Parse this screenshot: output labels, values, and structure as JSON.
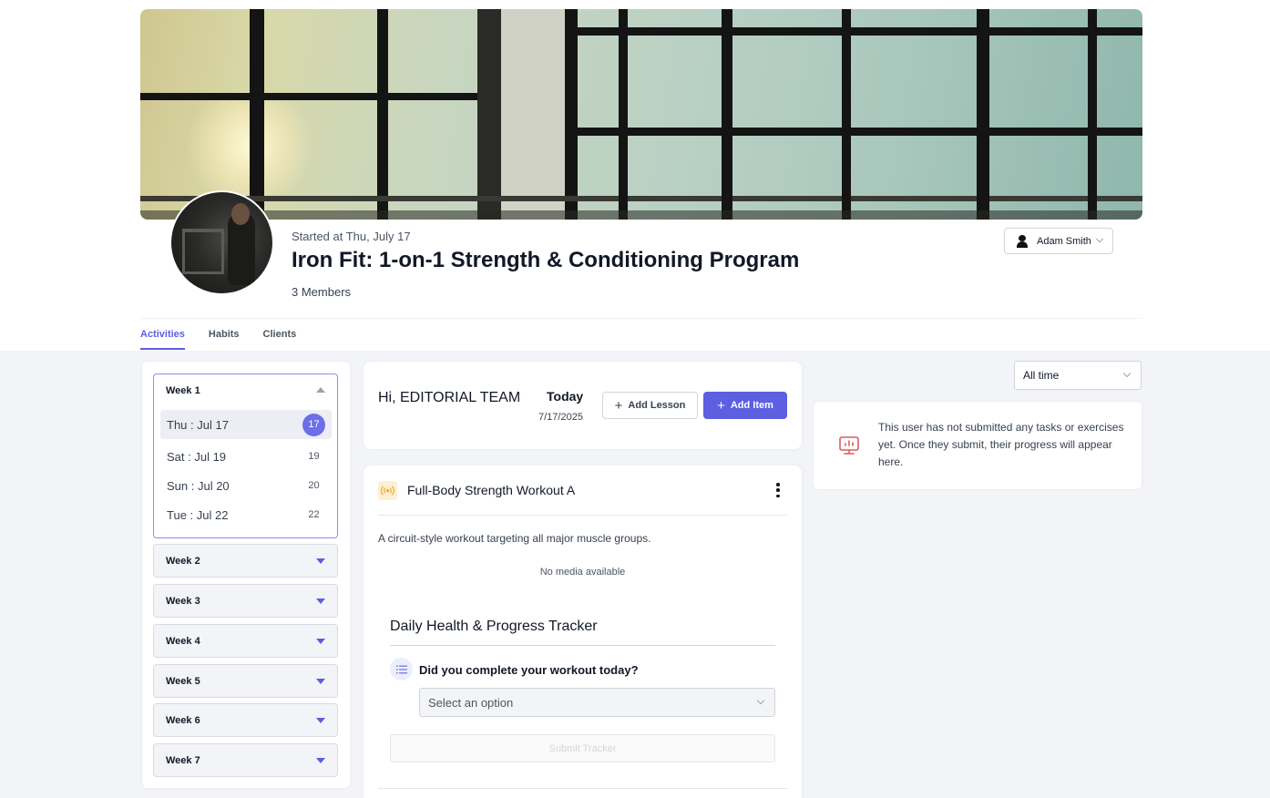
{
  "program": {
    "started": "Started at Thu, July 17",
    "title": "Iron Fit: 1-on-1 Strength & Conditioning Program",
    "members": "3 Members"
  },
  "user_menu": {
    "name": "Adam Smith",
    "icon": "user-icon"
  },
  "tabs": [
    {
      "label": "Activities",
      "active": true
    },
    {
      "label": "Habits",
      "active": false
    },
    {
      "label": "Clients",
      "active": false
    }
  ],
  "weeks": {
    "open": {
      "label": "Week 1",
      "days": [
        {
          "label": "Thu : Jul 17",
          "num": "17",
          "selected": true
        },
        {
          "label": "Sat : Jul 19",
          "num": "19",
          "selected": false
        },
        {
          "label": "Sun : Jul 20",
          "num": "20",
          "selected": false
        },
        {
          "label": "Tue : Jul 22",
          "num": "22",
          "selected": false
        }
      ]
    },
    "closed": [
      "Week 2",
      "Week 3",
      "Week 4",
      "Week 5",
      "Week 6",
      "Week 7"
    ]
  },
  "greeting": {
    "text": "Hi, EDITORIAL TEAM",
    "today_label": "Today",
    "today_date": "7/17/2025",
    "add_lesson": "Add Lesson",
    "add_item": "Add Item"
  },
  "workout": {
    "title": "Full-Body Strength Workout A",
    "description": "A circuit-style workout targeting all major muscle groups.",
    "no_media": "No media available",
    "icon": "signal-icon"
  },
  "tracker": {
    "title": "Daily Health & Progress Tracker",
    "question": "Did you complete your workout today?",
    "select_placeholder": "Select an option",
    "submit_label": "Submit Tracker"
  },
  "filter": {
    "selected": "All time"
  },
  "empty_state": {
    "text": "This user has not submitted any tasks or exercises yet. Once they submit, their progress will appear here.",
    "icon": "presentation-chart-icon",
    "icon_color": "#e05a5a"
  },
  "colors": {
    "accent": "#5b5fe0"
  }
}
